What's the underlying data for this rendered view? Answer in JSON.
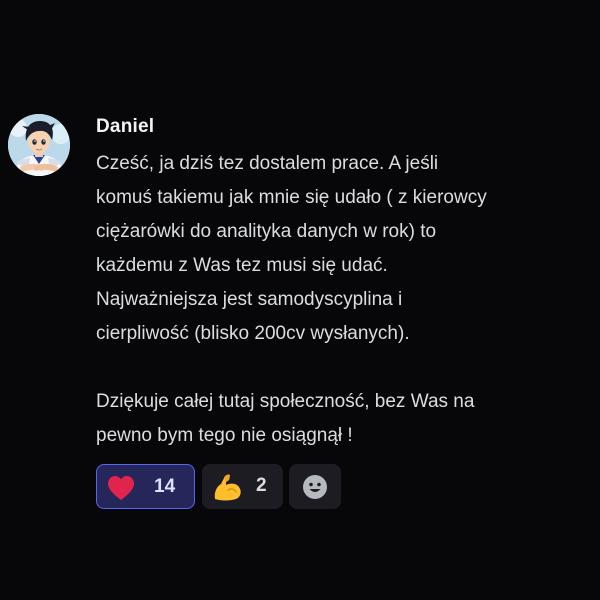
{
  "message": {
    "author": "Daniel",
    "paragraphs": [
      [
        "Cześć, ja dziś tez dostalem prace. A jeśli",
        "komuś takiemu jak mnie się udało ( z kierowcy",
        "ciężarówki do analityka danych w rok) to",
        "każdemu z Was tez musi się udać.",
        "Najważniejsza jest samodyscyplina i",
        "cierpliwość (blisko 200cv wysłanych)."
      ],
      [
        "Dziękuje całej tutaj społeczność, bez Was na",
        "pewno bym tego nie osiągnął !"
      ]
    ]
  },
  "reactions": [
    {
      "emoji": "heart-icon",
      "count": "14",
      "active": true,
      "color": "#e0244d"
    },
    {
      "emoji": "flexed-biceps-icon",
      "count": "2",
      "active": false,
      "color": "#ffbe2c"
    }
  ],
  "add_reaction": {
    "icon": "smiley-icon"
  },
  "colors": {
    "background": "#070709",
    "active_reaction_border": "#5865f2",
    "active_reaction_fill": "#25275a",
    "reaction_fill": "#1c1c22"
  }
}
